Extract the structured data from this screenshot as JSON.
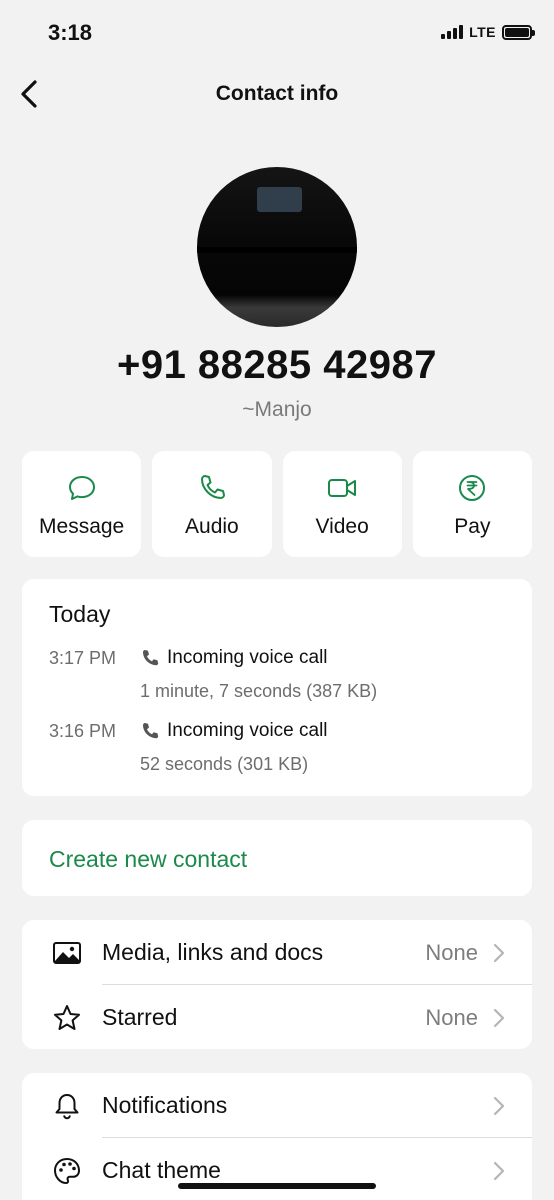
{
  "status": {
    "time": "3:18",
    "network": "LTE"
  },
  "nav": {
    "title": "Contact info"
  },
  "contact": {
    "phone": "+91 88285 42987",
    "alias": "~Manjo"
  },
  "actions": [
    {
      "label": "Message",
      "icon": "message-icon"
    },
    {
      "label": "Audio",
      "icon": "phone-icon"
    },
    {
      "label": "Video",
      "icon": "video-icon"
    },
    {
      "label": "Pay",
      "icon": "rupee-icon"
    }
  ],
  "calls": {
    "header": "Today",
    "items": [
      {
        "time": "3:17 PM",
        "title": "Incoming voice call",
        "detail": "1 minute, 7 seconds (387 KB)"
      },
      {
        "time": "3:16 PM",
        "title": "Incoming voice call",
        "detail": "52 seconds (301 KB)"
      }
    ]
  },
  "create_contact": "Create new contact",
  "media_rows": [
    {
      "label": "Media, links and docs",
      "value": "None",
      "icon": "image-icon"
    },
    {
      "label": "Starred",
      "value": "None",
      "icon": "star-icon"
    }
  ],
  "settings_rows": [
    {
      "label": "Notifications",
      "icon": "bell-icon"
    },
    {
      "label": "Chat theme",
      "icon": "palette-icon"
    }
  ],
  "colors": {
    "accent": "#1a8a4b",
    "background": "#f2f2f2",
    "card": "#ffffff"
  }
}
